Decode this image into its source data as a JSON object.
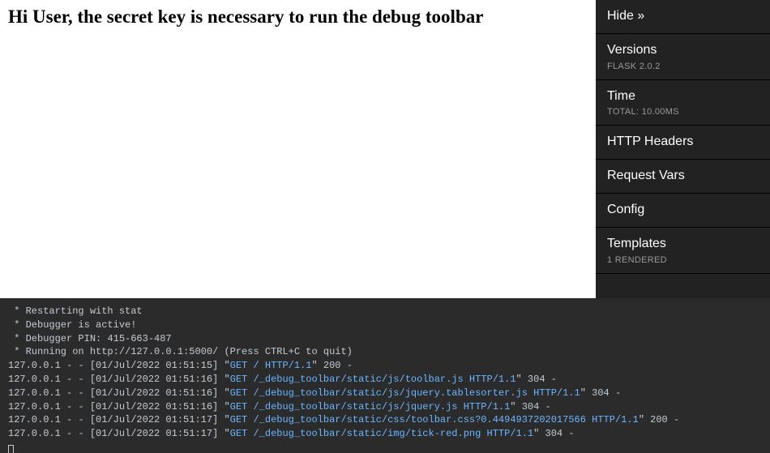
{
  "content": {
    "heading": "Hi User, the secret key is necessary to run the debug toolbar"
  },
  "sidebar": {
    "hide": {
      "label": "Hide »"
    },
    "versions": {
      "label": "Versions",
      "sub_prefix": "Flask",
      "sub_value": "2.0.2"
    },
    "time": {
      "label": "Time",
      "sub_prefix": "TOTAL:",
      "sub_value": "10.00",
      "sub_unit": "ms"
    },
    "http_headers": {
      "label": "HTTP Headers"
    },
    "request_vars": {
      "label": "Request Vars"
    },
    "config": {
      "label": "Config"
    },
    "templates": {
      "label": "Templates",
      "sub_prefix": "1",
      "sub_value": "rendered"
    }
  },
  "terminal": {
    "lines": [
      {
        "plain": " * Restarting with stat"
      },
      {
        "plain": " * Debugger is active!"
      },
      {
        "plain": " * Debugger PIN: 415-663-487"
      },
      {
        "plain": " * Running on http://127.0.0.1:5000/ (Press CTRL+C to quit)"
      },
      {
        "prefix": "127.0.0.1 - - [01/Jul/2022 01:51:15] \"",
        "link": "GET / HTTP/1.1",
        "suffix": "\" 200 -"
      },
      {
        "prefix": "127.0.0.1 - - [01/Jul/2022 01:51:16] \"",
        "link": "GET /_debug_toolbar/static/js/toolbar.js HTTP/1.1",
        "suffix": "\" 304 -"
      },
      {
        "prefix": "127.0.0.1 - - [01/Jul/2022 01:51:16] \"",
        "link": "GET /_debug_toolbar/static/js/jquery.tablesorter.js HTTP/1.1",
        "suffix": "\" 304 -"
      },
      {
        "prefix": "127.0.0.1 - - [01/Jul/2022 01:51:16] \"",
        "link": "GET /_debug_toolbar/static/js/jquery.js HTTP/1.1",
        "suffix": "\" 304 -"
      },
      {
        "prefix": "127.0.0.1 - - [01/Jul/2022 01:51:17] \"",
        "link": "GET /_debug_toolbar/static/css/toolbar.css?0.4494937202017566 HTTP/1.1",
        "suffix": "\" 200 -"
      },
      {
        "prefix": "127.0.0.1 - - [01/Jul/2022 01:51:17] \"",
        "link": "GET /_debug_toolbar/static/img/tick-red.png HTTP/1.1",
        "suffix": "\" 304 -"
      }
    ]
  }
}
